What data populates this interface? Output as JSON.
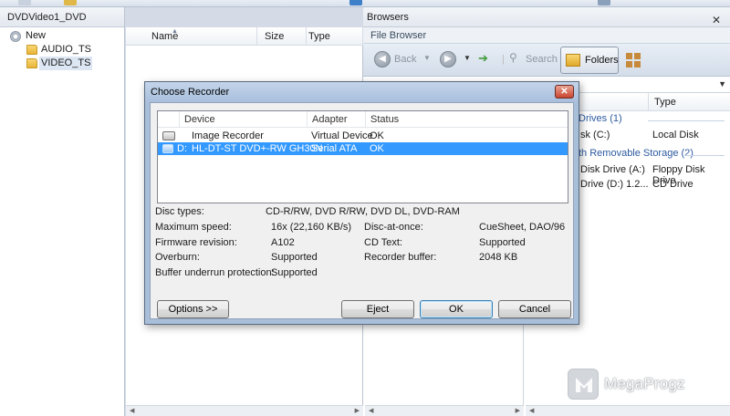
{
  "left_pane": {
    "title": "DVDVideo1_DVD",
    "tree": [
      {
        "label": "New"
      },
      {
        "label": "AUDIO_TS"
      },
      {
        "label": "VIDEO_TS"
      }
    ]
  },
  "file_list": {
    "columns": [
      "Name",
      "Size",
      "Type"
    ]
  },
  "browsers": {
    "title": "Browsers",
    "tab": "File Browser",
    "nav": {
      "back": "Back",
      "search": "Search",
      "folders": "Folders"
    },
    "columns": [
      "Type"
    ],
    "groups": [
      "Drives (1)",
      "th Removable Storage (2)"
    ],
    "rows": [
      {
        "name": "sk (C:)",
        "type": "Local Disk"
      },
      {
        "name": "Disk Drive (A:)",
        "type": "Floppy Disk Drive"
      },
      {
        "name": "Drive (D:) 1.2...",
        "type": "CD Drive"
      }
    ]
  },
  "dialog": {
    "title": "Choose Recorder",
    "columns": [
      "Device",
      "Adapter",
      "Status"
    ],
    "devices": [
      {
        "prefix": "",
        "device": "Image Recorder",
        "adapter": "Virtual Device",
        "status": "OK",
        "selected": false
      },
      {
        "prefix": "D:",
        "device": "HL-DT-ST DVD+-RW GH30N",
        "adapter": "Serial ATA",
        "status": "OK",
        "selected": true
      }
    ],
    "info_left": [
      {
        "label": "Disc types:",
        "value": "CD-R/RW, DVD R/RW, DVD DL, DVD-RAM"
      },
      {
        "label": "Maximum speed:",
        "value": "16x (22,160 KB/s)"
      },
      {
        "label": "Firmware revision:",
        "value": "A102"
      },
      {
        "label": "Overburn:",
        "value": "Supported"
      },
      {
        "label": "Buffer underrun protection:",
        "value": "Supported"
      }
    ],
    "info_right": [
      {
        "label": "Disc-at-once:",
        "value": "CueSheet, DAO/96"
      },
      {
        "label": "CD Text:",
        "value": "Supported"
      },
      {
        "label": "Recorder buffer:",
        "value": "2048 KB"
      }
    ],
    "buttons": {
      "options": "Options >>",
      "eject": "Eject",
      "ok": "OK",
      "cancel": "Cancel"
    },
    "selection_color": "#3399ff"
  },
  "watermark": {
    "text": "MegaProgz"
  }
}
